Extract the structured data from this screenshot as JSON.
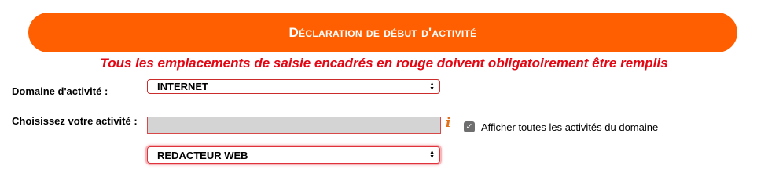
{
  "header": {
    "title": "Déclaration de début d'activité"
  },
  "notice": {
    "text": "Tous les emplacements de saisie encadrés en rouge doivent obligatoirement être remplis"
  },
  "form": {
    "domaine": {
      "label": "Domaine d'activité :",
      "selected": "INTERNET"
    },
    "activite": {
      "label": "Choisissez votre activité :",
      "input_value": "",
      "selected": "REDACTEUR WEB",
      "info_icon": "info-icon"
    },
    "show_all": {
      "label": "Afficher toutes les activités du domaine",
      "checked": true
    }
  },
  "colors": {
    "banner": "#ff5f00",
    "required_border": "#cc2b2b",
    "notice_text": "#e30613",
    "info_icon": "#e0701a"
  },
  "glyphs": {
    "info": "i",
    "check": "✓",
    "arrow_up": "▲",
    "arrow_down": "▼"
  }
}
